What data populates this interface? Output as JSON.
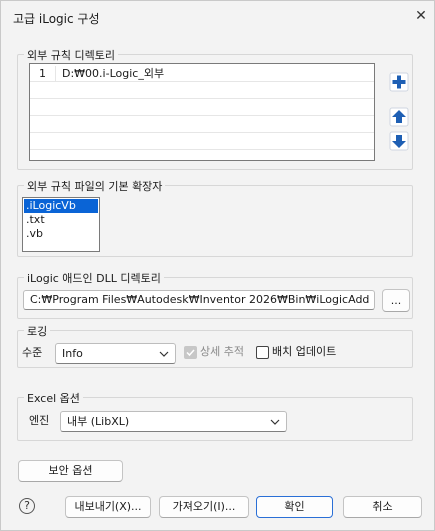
{
  "window": {
    "title": "고급 iLogic 구성",
    "close_glyph": "✕"
  },
  "external_dirs": {
    "label": "외부 규칙 디렉토리",
    "rows": [
      {
        "num": "1",
        "path": "D:₩00.i-Logic_외부"
      }
    ]
  },
  "extensions": {
    "label": "외부 규칙 파일의 기본 확장자",
    "items": [
      ".iLogicVb",
      ".txt",
      ".vb"
    ],
    "selected": ".iLogicVb"
  },
  "dll_dir": {
    "label": "iLogic 애드인 DLL 디렉토리",
    "value": "C:₩Program Files₩Autodesk₩Inventor 2026₩Bin₩iLogicAdd",
    "browse_label": "..."
  },
  "logging": {
    "label": "로깅",
    "level_label": "수준",
    "level_value": "Info",
    "detailed_trace_label": "상세 추적",
    "detailed_trace_checked": true,
    "detailed_trace_enabled": false,
    "batch_update_label": "배치 업데이트",
    "batch_update_checked": false
  },
  "excel": {
    "label": "Excel 옵션",
    "engine_label": "엔진",
    "engine_value": "내부 (LibXL)"
  },
  "buttons": {
    "security": "보안 옵션",
    "help": "?",
    "export": "내보내기(X)...",
    "import": "가져오기(I)...",
    "ok": "확인",
    "cancel": "취소"
  },
  "colors": {
    "accent": "#1e5fb4",
    "selection": "#0a64d6",
    "primary_border": "#2a6fd6"
  },
  "icons": [
    "add-icon",
    "move-up-icon",
    "move-down-icon",
    "chevron-down-icon",
    "checkmark-icon",
    "close-icon"
  ]
}
